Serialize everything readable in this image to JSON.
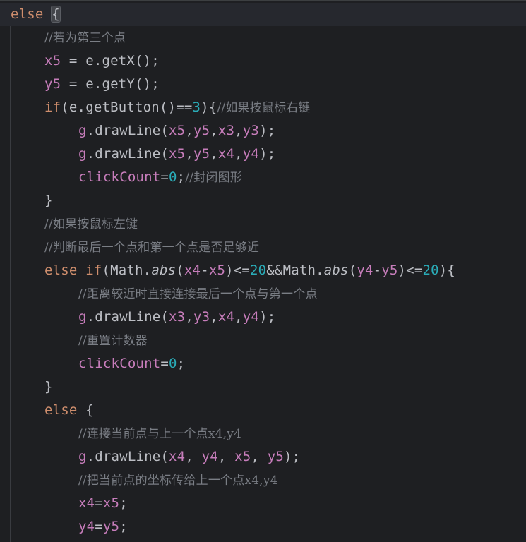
{
  "editor": {
    "lines": [
      {
        "indent": 0,
        "tokens": [
          {
            "t": "else",
            "c": "kw"
          },
          {
            "t": " "
          },
          {
            "t": "{",
            "c": "brace"
          }
        ]
      },
      {
        "indent": 1,
        "tokens": [
          {
            "t": "//若为第三个点",
            "c": "cmt"
          }
        ]
      },
      {
        "indent": 1,
        "tokens": [
          {
            "t": "x5",
            "c": "var"
          },
          {
            "t": " = e.getX();"
          }
        ]
      },
      {
        "indent": 1,
        "tokens": [
          {
            "t": "y5",
            "c": "var"
          },
          {
            "t": " = e.getY();"
          }
        ]
      },
      {
        "indent": 1,
        "tokens": [
          {
            "t": "if",
            "c": "kw"
          },
          {
            "t": "(e.getButton()=="
          },
          {
            "t": "3",
            "c": "num"
          },
          {
            "t": "){"
          },
          {
            "t": "//如果按鼠标右键",
            "c": "cmt"
          }
        ]
      },
      {
        "indent": 2,
        "tokens": [
          {
            "t": "g",
            "c": "var"
          },
          {
            "t": ".drawLine("
          },
          {
            "t": "x5",
            "c": "var"
          },
          {
            "t": ","
          },
          {
            "t": "y5",
            "c": "var"
          },
          {
            "t": ","
          },
          {
            "t": "x3",
            "c": "var"
          },
          {
            "t": ","
          },
          {
            "t": "y3",
            "c": "var"
          },
          {
            "t": ");"
          }
        ]
      },
      {
        "indent": 2,
        "tokens": [
          {
            "t": "g",
            "c": "var"
          },
          {
            "t": ".drawLine("
          },
          {
            "t": "x5",
            "c": "var"
          },
          {
            "t": ","
          },
          {
            "t": "y5",
            "c": "var"
          },
          {
            "t": ","
          },
          {
            "t": "x4",
            "c": "var"
          },
          {
            "t": ","
          },
          {
            "t": "y4",
            "c": "var"
          },
          {
            "t": ");"
          }
        ]
      },
      {
        "indent": 2,
        "tokens": [
          {
            "t": "clickCount",
            "c": "var"
          },
          {
            "t": "="
          },
          {
            "t": "0",
            "c": "num"
          },
          {
            "t": ";"
          },
          {
            "t": "//封闭图形",
            "c": "cmt"
          }
        ]
      },
      {
        "indent": 1,
        "tokens": [
          {
            "t": "}"
          }
        ]
      },
      {
        "indent": 1,
        "tokens": [
          {
            "t": "//如果按鼠标左键",
            "c": "cmt"
          }
        ]
      },
      {
        "indent": 1,
        "tokens": [
          {
            "t": "//判断最后一个点和第一个点是否足够近",
            "c": "cmt"
          }
        ]
      },
      {
        "indent": 1,
        "tokens": [
          {
            "t": "else if",
            "c": "kw"
          },
          {
            "t": "(Math."
          },
          {
            "t": "abs",
            "c": "it"
          },
          {
            "t": "("
          },
          {
            "t": "x4",
            "c": "var"
          },
          {
            "t": "-"
          },
          {
            "t": "x5",
            "c": "var"
          },
          {
            "t": ")<="
          },
          {
            "t": "20",
            "c": "num"
          },
          {
            "t": "&&Math."
          },
          {
            "t": "abs",
            "c": "it"
          },
          {
            "t": "("
          },
          {
            "t": "y4",
            "c": "var"
          },
          {
            "t": "-"
          },
          {
            "t": "y5",
            "c": "var"
          },
          {
            "t": ")<="
          },
          {
            "t": "20",
            "c": "num"
          },
          {
            "t": "){"
          }
        ]
      },
      {
        "indent": 2,
        "tokens": [
          {
            "t": "//距离较近时直接连接最后一个点与第一个点",
            "c": "cmt"
          }
        ]
      },
      {
        "indent": 2,
        "tokens": [
          {
            "t": "g",
            "c": "var"
          },
          {
            "t": ".drawLine("
          },
          {
            "t": "x3",
            "c": "var"
          },
          {
            "t": ","
          },
          {
            "t": "y3",
            "c": "var"
          },
          {
            "t": ","
          },
          {
            "t": "x4",
            "c": "var"
          },
          {
            "t": ","
          },
          {
            "t": "y4",
            "c": "var"
          },
          {
            "t": ");"
          }
        ]
      },
      {
        "indent": 2,
        "tokens": [
          {
            "t": "//重置计数器",
            "c": "cmt"
          }
        ]
      },
      {
        "indent": 2,
        "tokens": [
          {
            "t": "clickCount",
            "c": "var"
          },
          {
            "t": "="
          },
          {
            "t": "0",
            "c": "num"
          },
          {
            "t": ";"
          }
        ]
      },
      {
        "indent": 1,
        "tokens": [
          {
            "t": "}"
          }
        ]
      },
      {
        "indent": 1,
        "tokens": [
          {
            "t": "else",
            "c": "kw"
          },
          {
            "t": " {"
          }
        ]
      },
      {
        "indent": 2,
        "tokens": [
          {
            "t": "//连接当前点与上一个点x4,y4",
            "c": "cmt"
          }
        ]
      },
      {
        "indent": 2,
        "tokens": [
          {
            "t": "g",
            "c": "var"
          },
          {
            "t": ".drawLine("
          },
          {
            "t": "x4",
            "c": "var"
          },
          {
            "t": ", "
          },
          {
            "t": "y4",
            "c": "var"
          },
          {
            "t": ", "
          },
          {
            "t": "x5",
            "c": "var"
          },
          {
            "t": ", "
          },
          {
            "t": "y5",
            "c": "var"
          },
          {
            "t": ");"
          }
        ]
      },
      {
        "indent": 2,
        "tokens": [
          {
            "t": "//把当前点的坐标传给上一个点x4,y4",
            "c": "cmt"
          }
        ]
      },
      {
        "indent": 2,
        "tokens": [
          {
            "t": "x4",
            "c": "var"
          },
          {
            "t": "="
          },
          {
            "t": "x5",
            "c": "var"
          },
          {
            "t": ";"
          }
        ]
      },
      {
        "indent": 2,
        "tokens": [
          {
            "t": "y4",
            "c": "var"
          },
          {
            "t": "="
          },
          {
            "t": "y5",
            "c": "var"
          },
          {
            "t": ";"
          }
        ]
      }
    ]
  },
  "colors": {
    "background": "#1e1f22",
    "current_line": "#26282e",
    "keyword": "#cf8e6d",
    "variable": "#c77dbb",
    "number": "#2aacb8",
    "comment": "#7a7e85",
    "text": "#bcbec4"
  }
}
